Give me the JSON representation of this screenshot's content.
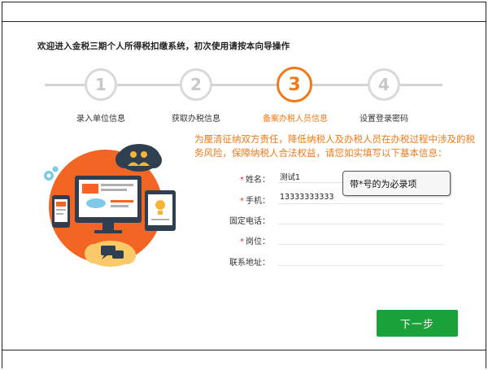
{
  "wizard": {
    "welcome_text": "欢迎进入金税三期个人所得税扣缴系统，初次使用请按本向导操作",
    "steps": [
      {
        "number": "1",
        "label": "录入单位信息"
      },
      {
        "number": "2",
        "label": "获取办税信息"
      },
      {
        "number": "3",
        "label": "备案办税人员信息"
      },
      {
        "number": "4",
        "label": "设置登录密码"
      }
    ],
    "active_step": 3,
    "accent_color": "#f07a1a"
  },
  "intro_text": "为厘清征纳双方责任，降低纳税人及办税人员在办税过程中涉及的税务风险，保障纳税人合法权益，请您如实填写以下基本信息：",
  "form": {
    "name": {
      "label": "姓名：",
      "required": true,
      "value": "测试1"
    },
    "phone": {
      "label": "手机：",
      "required": true,
      "value": "13333333333"
    },
    "landline": {
      "label": "固定电话：",
      "required": false,
      "value": ""
    },
    "position": {
      "label": "岗位：",
      "required": false,
      "value": ""
    },
    "address": {
      "label": "联系地址：",
      "required": false,
      "value": ""
    },
    "required_mark": "*"
  },
  "tooltip": {
    "text": "带*号的为必录项"
  },
  "next_button": {
    "label": "下一步",
    "color": "#1aa13a"
  }
}
